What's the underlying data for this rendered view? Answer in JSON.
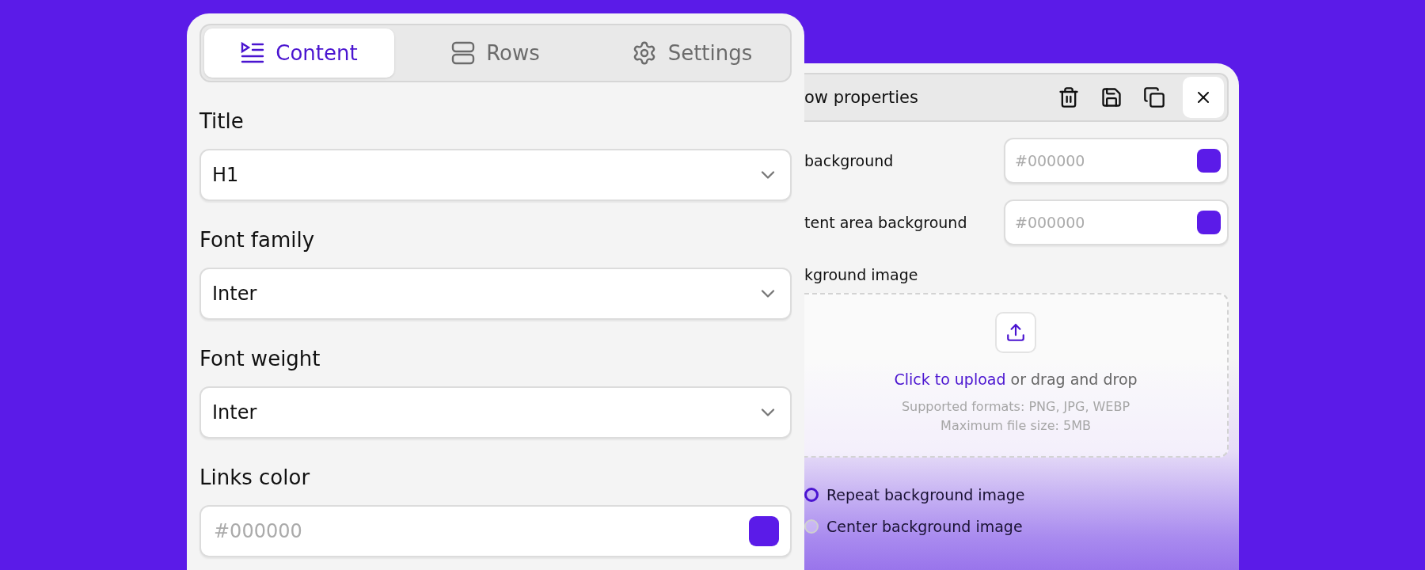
{
  "tabs": [
    {
      "label": "Content",
      "selected": true
    },
    {
      "label": "Rows",
      "selected": false
    },
    {
      "label": "Settings",
      "selected": false
    }
  ],
  "fields": [
    {
      "label": "Title",
      "kind": "select",
      "value": "H1"
    },
    {
      "label": "Font family",
      "kind": "select",
      "value": "Inter"
    },
    {
      "label": "Font weight",
      "kind": "select",
      "value": "Inter"
    },
    {
      "label": "Links color",
      "kind": "color",
      "placeholder": "#000000",
      "color": "#5b1be8"
    }
  ],
  "row_properties": {
    "title": "ow properties",
    "color_fields": [
      {
        "label": "background",
        "placeholder": "#000000",
        "color": "#5b1be8"
      },
      {
        "label": "tent area background",
        "placeholder": "#000000",
        "color": "#5b1be8"
      }
    ],
    "image_section": {
      "label": "kground image",
      "upload_link": "Click to upload",
      "upload_text": "or drag and drop",
      "formats": "Supported formats: PNG, JPG, WEBP",
      "max_size": "Maximum file size: 5MB"
    },
    "options": [
      {
        "label": "Repeat background image",
        "selected": true
      },
      {
        "label": "Center background image",
        "selected": false
      }
    ]
  }
}
